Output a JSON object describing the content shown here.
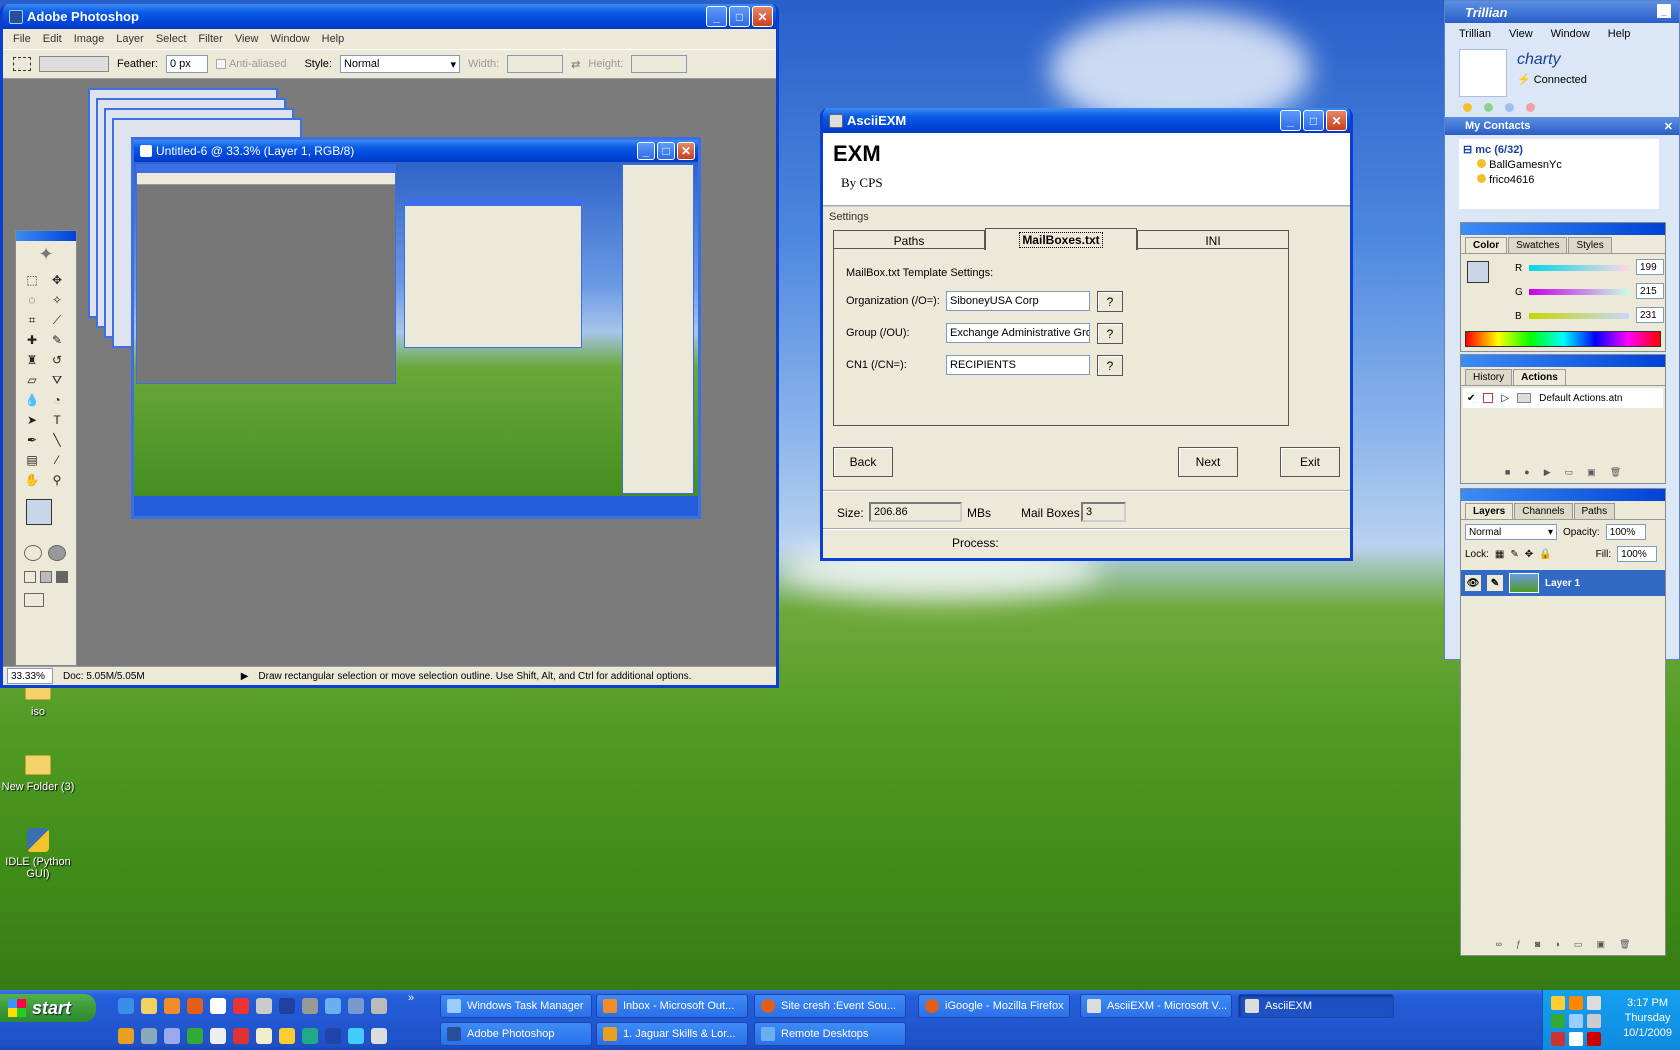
{
  "photoshop": {
    "title": "Adobe Photoshop",
    "menu": [
      "File",
      "Edit",
      "Image",
      "Layer",
      "Select",
      "Filter",
      "View",
      "Window",
      "Help"
    ],
    "options": {
      "feather_label": "Feather:",
      "feather_value": "0 px",
      "antialiased_label": "Anti-aliased",
      "style_label": "Style:",
      "style_value": "Normal",
      "width_label": "Width:",
      "height_label": "Height:"
    },
    "doc_title": "Untitled-6 @ 33.3% (Layer 1, RGB/8)",
    "status": {
      "zoom": "33.33%",
      "doc": "Doc: 5.05M/5.05M",
      "hint": "Draw rectangular selection or move selection outline.  Use Shift, Alt, and Ctrl for additional options."
    }
  },
  "asciiexm": {
    "title": "AsciiEXM",
    "app_name": "EXM",
    "byline": "By CPS",
    "settings_label": "Settings",
    "tabs": [
      "Paths",
      "MailBoxes.txt",
      "INI"
    ],
    "active_tab": "MailBoxes.txt",
    "section_title": "MailBox.txt Template Settings:",
    "fields": [
      {
        "label": "Organization (/O=):",
        "value": "SiboneyUSA Corp",
        "help": "?"
      },
      {
        "label": "Group (/OU):",
        "value": "Exchange Administrative Gro",
        "help": "?"
      },
      {
        "label": "CN1 (/CN=):",
        "value": "RECIPIENTS",
        "help": "?"
      }
    ],
    "buttons": {
      "back": "Back",
      "next": "Next",
      "exit": "Exit"
    },
    "size_label": "Size:",
    "size_value": "206.86",
    "size_unit": "MBs",
    "mailboxes_label": "Mail Boxes",
    "mailboxes_value": "3",
    "process_label": "Process:"
  },
  "trillian": {
    "brand": "Trillian",
    "menu": [
      "Trillian",
      "View",
      "Window",
      "Help"
    ],
    "user": "charty",
    "status": "Connected",
    "contacts_header": "My Contacts",
    "group": "mc (6/32)",
    "contacts": [
      "BallGamesnYc",
      "frico4616"
    ]
  },
  "ps_panels": {
    "color_tabs": [
      "Color",
      "Swatches",
      "Styles"
    ],
    "r_label": "R",
    "r": "199",
    "g_label": "G",
    "g": "215",
    "b_label": "B",
    "b": "231",
    "history_tabs": [
      "History",
      "Actions"
    ],
    "actions_item": "Default Actions.atn",
    "layers_tabs": [
      "Layers",
      "Channels",
      "Paths"
    ],
    "blend": "Normal",
    "opacity_label": "Opacity:",
    "opacity": "100%",
    "lock_label": "Lock:",
    "fill_label": "Fill:",
    "fill": "100%",
    "layer_name": "Layer 1"
  },
  "desktop_icons": [
    "iso",
    "New Folder (3)",
    "IDLE (Python GUI)"
  ],
  "taskbar": {
    "start": "start",
    "row1": [
      "Windows Task Manager",
      "Inbox - Microsoft Out...",
      "Site cresh :Event Sou...",
      "iGoogle - Mozilla Firefox",
      "AsciiEXM - Microsoft V...",
      "AsciiEXM"
    ],
    "row2": [
      "Adobe Photoshop",
      "1. Jaguar Skills & Lor...",
      "Remote Desktops"
    ],
    "time": "3:17 PM",
    "day": "Thursday",
    "date": "10/1/2009"
  },
  "colors": {
    "xp_blue": "#0054e3",
    "taskbar": "#245edb",
    "start_green": "#3c9a3c"
  }
}
